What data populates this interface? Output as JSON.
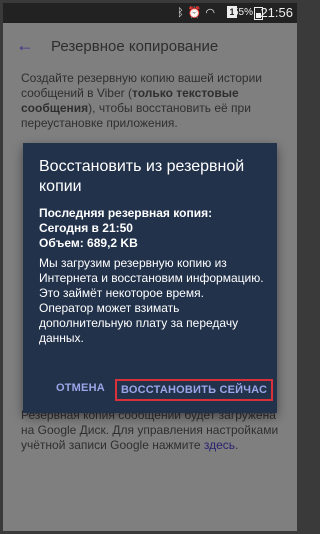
{
  "status_bar": {
    "icons": [
      "bluetooth-icon",
      "alarm-icon",
      "wifi-icon",
      "signal-icon"
    ],
    "sim": "1",
    "battery": "55%",
    "time": "21:56"
  },
  "app_bar": {
    "title": "Резервное копирование"
  },
  "background": {
    "description_part1": "Создайте резервную копию вашей истории сообщений в Viber (",
    "description_bold": "только текстовые сообщения",
    "description_part2": "), чтобы восстановить её при переустановке приложения.",
    "bottom_text": "Резервная копия сообщений будет загружена на Google Диск. Для управления настройками учётной записи Google нажмите ",
    "bottom_link": "здесь",
    "bottom_end": "."
  },
  "dialog": {
    "title": "Восстановить из резервной копии",
    "last_backup_label": "Последняя резервная копия:",
    "last_backup_time": "Сегодня в 21:50",
    "size": "Объем: 689,2 KB",
    "message_line1": "Мы загрузим резервную копию из Интернета и восстановим информацию.",
    "message_line2": "Это займёт некоторое время.",
    "message_line3": "Оператор может взимать дополнительную плату за передачу данных.",
    "cancel_label": "ОТМЕНА",
    "restore_label": "ВОССТАНОВИТЬ СЕЙЧАС"
  },
  "colors": {
    "dialog_bg": "#22324b",
    "accent": "#45318a",
    "button_text": "#9aa6e8",
    "highlight": "#d9303a"
  }
}
